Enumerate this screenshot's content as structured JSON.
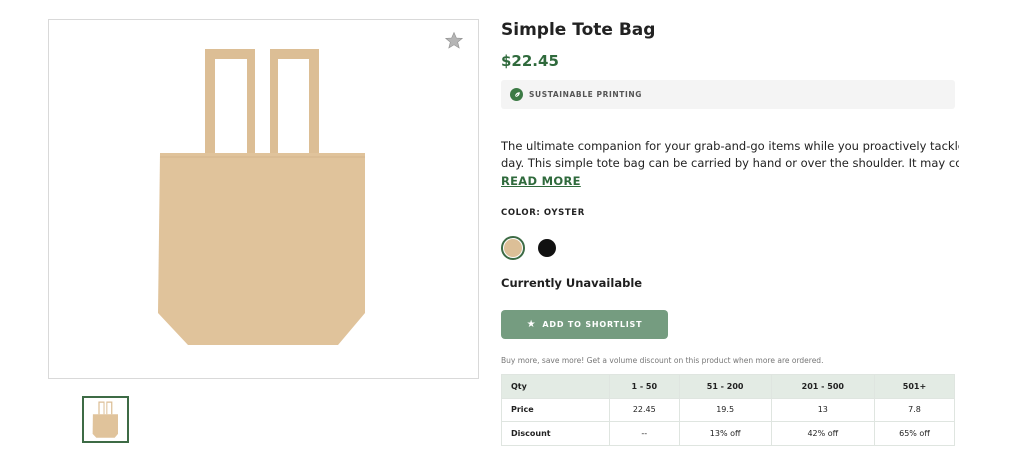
{
  "product": {
    "title": "Simple Tote Bag",
    "price": "$22.45",
    "badge": "SUSTAINABLE PRINTING",
    "description_lines": [
      "The ultimate companion for your grab-and-go items while you proactively tackle your",
      "day. This simple tote bag can be carried by hand or over the shoulder. It may come i..."
    ],
    "read_more": "READ MORE",
    "color_label": "COLOR: OYSTER",
    "colors": [
      {
        "name": "oyster",
        "hex": "#dcbf97",
        "selected": true
      },
      {
        "name": "black",
        "hex": "#111111",
        "selected": false
      }
    ],
    "availability": "Currently Unavailable",
    "shortlist_button": "ADD TO SHORTLIST",
    "image_color": "#e0c39b"
  },
  "volume_discount": {
    "promo": "Buy more, save more! Get a volume discount on this product when more are ordered.",
    "header": [
      "Qty",
      "1 - 50",
      "51 - 200",
      "201 - 500",
      "501+"
    ],
    "rows": [
      [
        "Price",
        "22.45",
        "19.5",
        "13",
        "7.8"
      ],
      [
        "Discount",
        "--",
        "13% off",
        "42% off",
        "65% off"
      ]
    ]
  },
  "colors": {
    "accent": "#2f6a3c",
    "button": "#759c80",
    "table_header": "#e3ebe4"
  }
}
